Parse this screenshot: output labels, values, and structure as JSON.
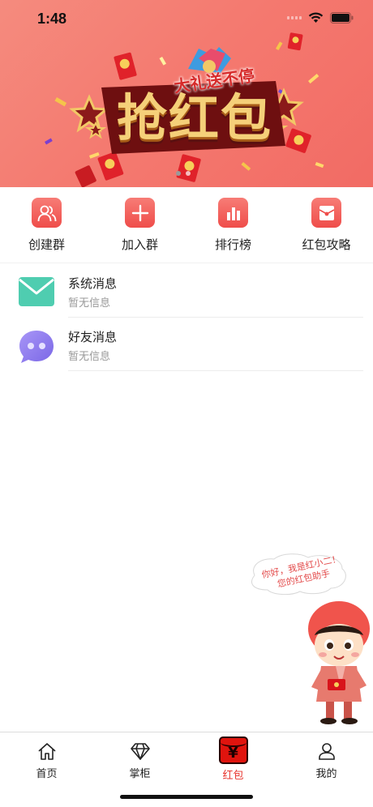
{
  "status_bar": {
    "time": "1:48"
  },
  "banner": {
    "main_text": "抢红包",
    "ribbon_text": "大礼送不停",
    "colors": {
      "background": "#f47a70",
      "gold": "#f2c866",
      "red": "#d8262a"
    }
  },
  "actions": [
    {
      "label": "创建群",
      "icon": "users-icon"
    },
    {
      "label": "加入群",
      "icon": "plus-icon"
    },
    {
      "label": "排行榜",
      "icon": "bar-chart-icon"
    },
    {
      "label": "红包攻略",
      "icon": "red-envelope-icon"
    }
  ],
  "messages": [
    {
      "title": "系统消息",
      "subtitle": "暂无信息",
      "icon": "envelope-icon",
      "color": "#4fcdb0"
    },
    {
      "title": "好友消息",
      "subtitle": "暂无信息",
      "icon": "chat-bubble-icon",
      "color": "#8b7cf0"
    }
  ],
  "mascot": {
    "line1": "你好，我是红小二！",
    "line2": "您的红包助手"
  },
  "tabs": [
    {
      "label": "首页",
      "icon": "home-icon",
      "active": false
    },
    {
      "label": "掌柜",
      "icon": "diamond-icon",
      "active": false
    },
    {
      "label": "红包",
      "icon": "red-envelope-icon",
      "active": true,
      "icon_glyph": "¥"
    },
    {
      "label": "我的",
      "icon": "user-icon",
      "active": false
    }
  ],
  "accent_color": "#e8362f"
}
